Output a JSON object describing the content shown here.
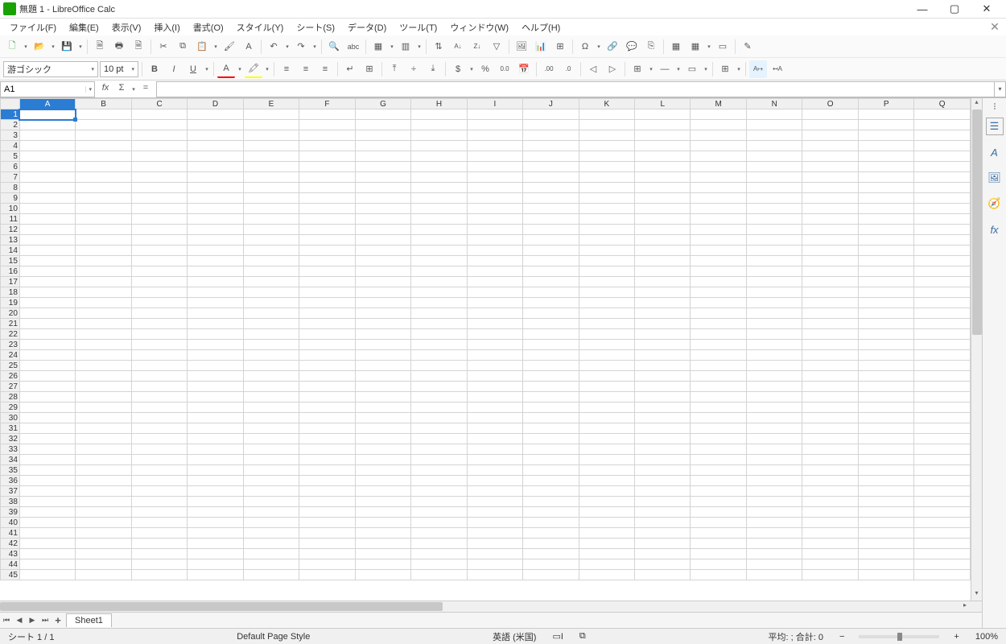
{
  "title": "無題 1 - LibreOffice Calc",
  "window_controls": {
    "min": "—",
    "max": "▢",
    "close": "✕",
    "doc_close": "✕"
  },
  "menus": [
    "ファイル(F)",
    "編集(E)",
    "表示(V)",
    "挿入(I)",
    "書式(O)",
    "スタイル(Y)",
    "シート(S)",
    "データ(D)",
    "ツール(T)",
    "ウィンドウ(W)",
    "ヘルプ(H)"
  ],
  "font": {
    "name": "游ゴシック",
    "size": "10 pt"
  },
  "name_box": "A1",
  "fx_label": "fx",
  "sigma_label": "Σ",
  "equals_label": "=",
  "columns": [
    "A",
    "B",
    "C",
    "D",
    "E",
    "F",
    "G",
    "H",
    "I",
    "J",
    "K",
    "L",
    "M",
    "N",
    "O",
    "P",
    "Q"
  ],
  "rows": 45,
  "selected": {
    "col": 0,
    "row": 0
  },
  "sheet_tab": "Sheet1",
  "tab_add": "+",
  "status": {
    "sheet_count": "シート 1 / 1",
    "page_style": "Default Page Style",
    "language": "英語 (米国)",
    "insert_mode": "▭I",
    "selection_mode": "⧉",
    "summary": "平均: ; 合計: 0",
    "zoom_minus": "−",
    "zoom_plus": "+",
    "zoom": "100%"
  },
  "toolbar_icons": {
    "new": "🗋",
    "open": "📂",
    "save": "💾",
    "pdf": "🗎",
    "print": "🖶",
    "preview": "🗎",
    "cut": "✂",
    "copy": "⧉",
    "paste": "📋",
    "clone": "🖌",
    "clear": "A",
    "undo": "↶",
    "redo": "↷",
    "find": "🔍",
    "spell": "abc",
    "row": "▦",
    "col": "▥",
    "sort": "⇅",
    "sort_asc": "A↓",
    "sort_desc": "Z↓",
    "filter": "▽",
    "image": "🖼",
    "chart": "📊",
    "pivot": "⊞",
    "special": "Ω",
    "link": "🔗",
    "comment": "💬",
    "header": "⎘",
    "freeze": "▦",
    "split": "▦",
    "window": "▭",
    "draw": "✎"
  },
  "format_icons": {
    "bold": "B",
    "italic": "I",
    "underline": "U",
    "font_color": "A",
    "highlight": "🖍",
    "align_left": "≡",
    "align_center": "≡",
    "align_right": "≡",
    "justify": "≡",
    "wrap": "↵",
    "merge": "⊞",
    "valign_top": "⤒",
    "valign_mid": "⧾",
    "valign_bot": "⤓",
    "currency": "$",
    "percent": "%",
    "number": "0.0",
    "date": "📅",
    "dec_add": ".00",
    "dec_rem": ".0",
    "indent_dec": "◁",
    "indent_inc": "▷",
    "borders": "⊞",
    "border_style": "—",
    "border_color": "▭",
    "cond": "⊞",
    "ltr": "A↦",
    "rtl": "↤A"
  },
  "sidebar_icons": {
    "properties": "☰",
    "styles": "A",
    "gallery": "🖼",
    "navigator": "🧭",
    "functions": "fx"
  }
}
